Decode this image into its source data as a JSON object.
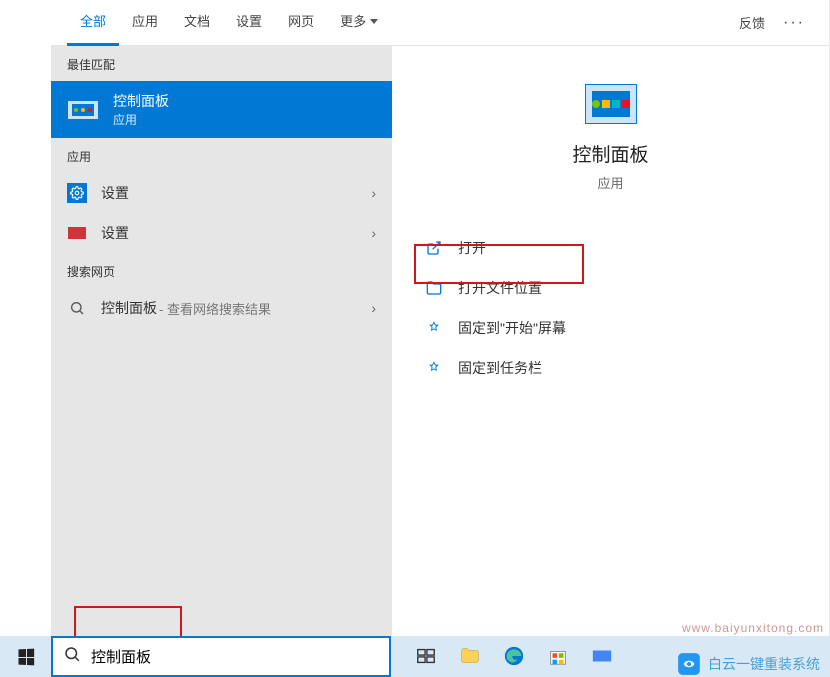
{
  "tabs": {
    "all": "全部",
    "apps": "应用",
    "docs": "文档",
    "settings": "设置",
    "web": "网页",
    "more": "更多"
  },
  "header": {
    "feedback": "反馈"
  },
  "left": {
    "best_match_header": "最佳匹配",
    "best_match": {
      "title": "控制面板",
      "subtitle": "应用"
    },
    "apps_header": "应用",
    "apps": [
      {
        "label": "设置",
        "icon": "settings-blue"
      },
      {
        "label": "设置",
        "icon": "settings-red"
      }
    ],
    "web_header": "搜索网页",
    "web_item": {
      "label": "控制面板",
      "sub": " - 查看网络搜索结果"
    }
  },
  "right": {
    "title": "控制面板",
    "subtitle": "应用",
    "actions": {
      "open": "打开",
      "open_location": "打开文件位置",
      "pin_start": "固定到\"开始\"屏幕",
      "pin_taskbar": "固定到任务栏"
    }
  },
  "search": {
    "value": "控制面板"
  },
  "watermark": {
    "brand": "白云一键重装系统",
    "url": "www.baiyunxitong.com"
  }
}
